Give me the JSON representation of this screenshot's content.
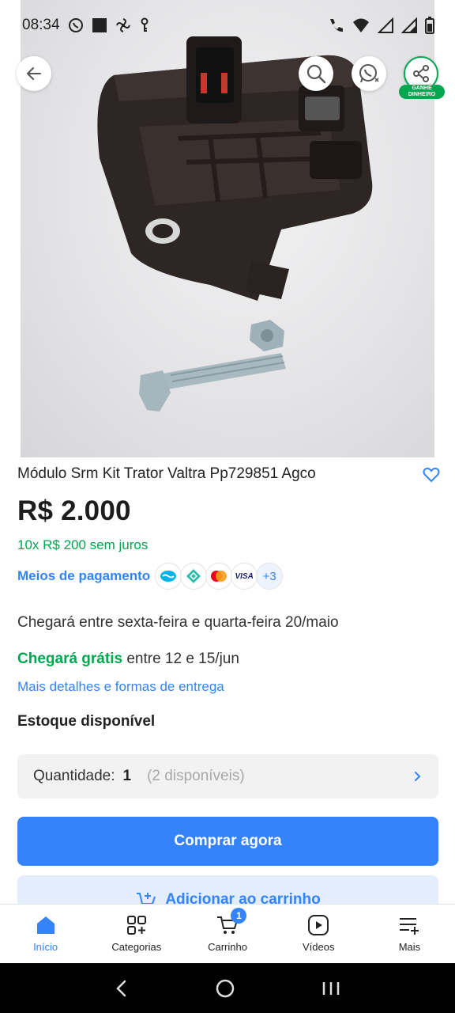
{
  "status_bar": {
    "time": "08:34"
  },
  "hero": {
    "share_badge": "GANHE DINHEIRO"
  },
  "product": {
    "title": "Módulo Srm Kit Trator Valtra Pp729851 Agco",
    "price": "R$ 2.000",
    "installments": "10x R$ 200 sem juros",
    "payment_link": "Meios de pagamento",
    "payment_icons": [
      "mercado-pago-icon",
      "pix-icon",
      "mastercard-icon",
      "visa-icon"
    ],
    "visa_label": "VISA",
    "payment_more": "+3"
  },
  "shipping": {
    "arrival": "Chegará entre sexta-feira e quarta-feira 20/maio",
    "free_bold": "Chegará grátis",
    "free_rest": " entre 12 e 15/jun",
    "details_link": "Mais detalhes e formas de entrega"
  },
  "stock": {
    "label": "Estoque disponível",
    "quantity_label": "Quantidade:",
    "quantity_value": "1",
    "available": "(2 disponíveis)"
  },
  "actions": {
    "buy_now": "Comprar agora",
    "add_to_cart": "Adicionar ao carrinho"
  },
  "bottom_nav": {
    "items": [
      {
        "label": "Início",
        "icon": "home-icon",
        "active": true
      },
      {
        "label": "Categorias",
        "icon": "categories-icon",
        "active": false
      },
      {
        "label": "Carrinho",
        "icon": "cart-icon",
        "active": false,
        "badge": "1"
      },
      {
        "label": "Vídeos",
        "icon": "video-icon",
        "active": false
      },
      {
        "label": "Mais",
        "icon": "menu-plus-icon",
        "active": false
      }
    ]
  },
  "colors": {
    "accent_blue": "#3483fa",
    "green": "#00a650",
    "light_blue_bg": "#e3edfb"
  }
}
